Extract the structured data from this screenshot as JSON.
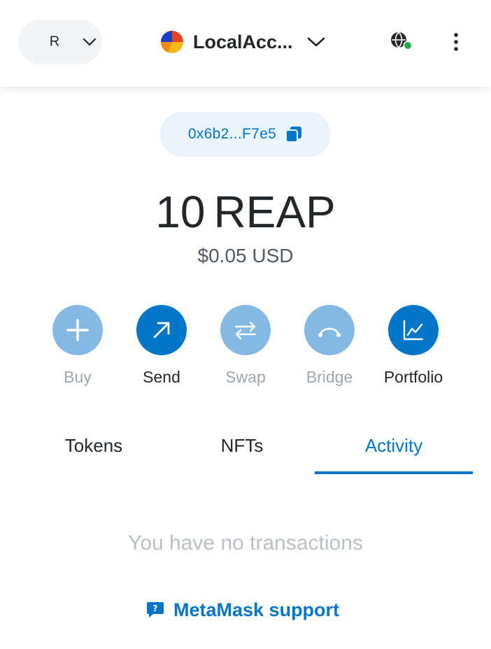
{
  "header": {
    "network_letter": "R",
    "account_name": "LocalAcc...",
    "menu_icon": "kebab-menu-icon",
    "connected_status_color": "#28a745"
  },
  "address": {
    "short": "0x6b2...F7e5",
    "copy_icon": "copy-icon"
  },
  "balance": {
    "amount": "10",
    "unit": "REAP",
    "fiat": "$0.05 USD"
  },
  "actions": [
    {
      "label": "Buy",
      "icon": "plus-icon",
      "enabled": false
    },
    {
      "label": "Send",
      "icon": "arrow-up-right-icon",
      "enabled": true
    },
    {
      "label": "Swap",
      "icon": "swap-arrows-icon",
      "enabled": false
    },
    {
      "label": "Bridge",
      "icon": "bridge-icon",
      "enabled": false
    },
    {
      "label": "Portfolio",
      "icon": "chart-icon",
      "enabled": true
    }
  ],
  "tabs": [
    {
      "label": "Tokens",
      "active": false
    },
    {
      "label": "NFTs",
      "active": false
    },
    {
      "label": "Activity",
      "active": true
    }
  ],
  "activity": {
    "empty_message": "You have no transactions"
  },
  "support": {
    "label": "MetaMask support"
  },
  "colors": {
    "primary": "#0376c9",
    "primary_disabled": "#85b9e4",
    "text": "#24272a",
    "muted": "#9fa6ae"
  }
}
